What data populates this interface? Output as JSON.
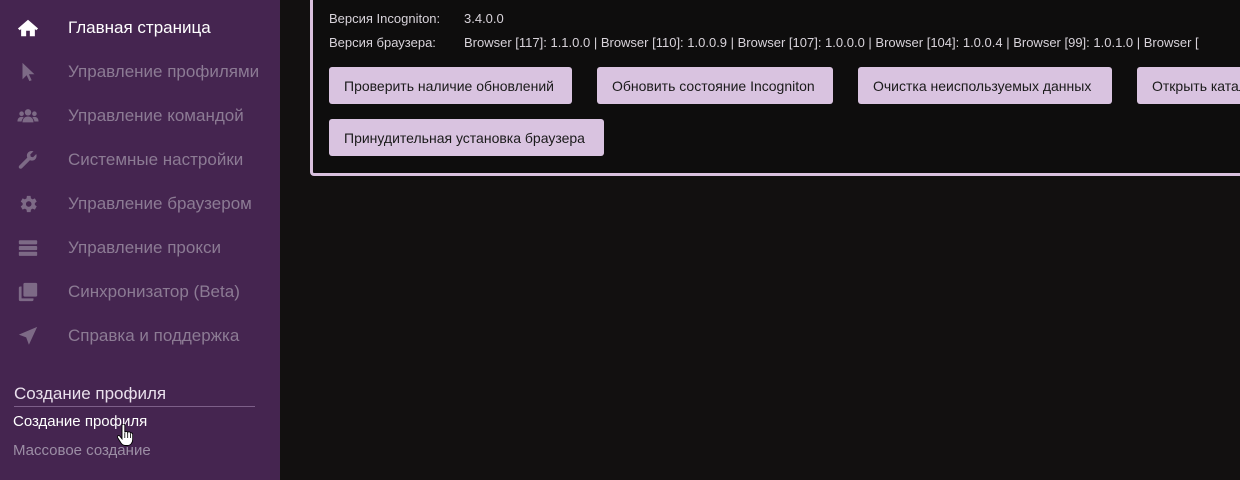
{
  "sidebar": {
    "nav": [
      {
        "label": "Главная страница",
        "icon": "home-icon"
      },
      {
        "label": "Управление профилями",
        "icon": "cursor-icon"
      },
      {
        "label": "Управление командой",
        "icon": "users-icon"
      },
      {
        "label": "Системные настройки",
        "icon": "wrench-icon"
      },
      {
        "label": "Управление браузером",
        "icon": "gear-icon"
      },
      {
        "label": "Управление прокси",
        "icon": "server-icon"
      },
      {
        "label": "Синхронизатор (Beta)",
        "icon": "copy-icon"
      },
      {
        "label": "Справка и поддержка",
        "icon": "paper-plane-icon"
      }
    ],
    "section_title": "Создание профиля",
    "sub_items": [
      "Создание профиля",
      "Массовое создание"
    ]
  },
  "panel": {
    "version_label": "Версия Incogniton:",
    "version_value": "3.4.0.0",
    "browser_label": "Версия браузера:",
    "browser_value": "Browser [117]: 1.1.0.0 | Browser [110]: 1.0.0.9 | Browser [107]: 1.0.0.0 | Browser [104]: 1.0.0.4 | Browser [99]: 1.0.1.0 | Browser [",
    "buttons": [
      "Проверить наличие обновлений",
      "Обновить состояние Incogniton",
      "Очистка неиспользуемых данных",
      "Открыть каталог",
      "Принудительная установка браузера"
    ]
  },
  "colors": {
    "sidebar_bg": "#452550",
    "button_bg": "#d9c3e0",
    "panel_border": "#d9c0de"
  }
}
